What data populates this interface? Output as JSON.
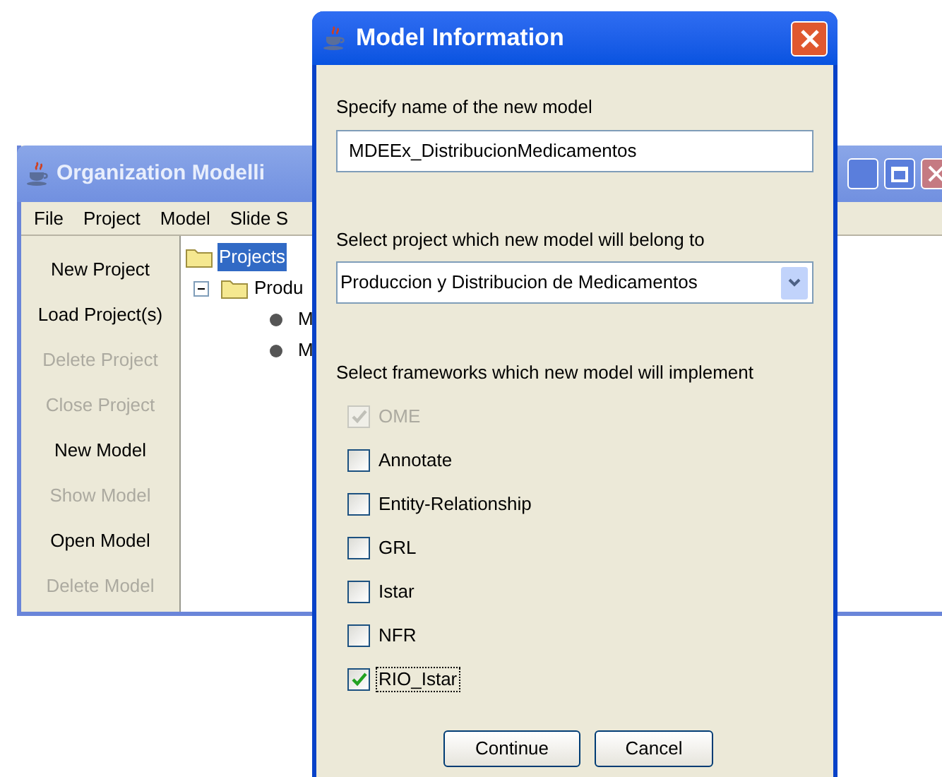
{
  "main_window": {
    "title": "Organization Modelli",
    "menu": [
      "File",
      "Project",
      "Model",
      "Slide S"
    ],
    "actions": [
      {
        "label": "New Project",
        "disabled": false
      },
      {
        "label": "Load Project(s)",
        "disabled": false
      },
      {
        "label": "Delete Project",
        "disabled": true
      },
      {
        "label": "Close Project",
        "disabled": true
      },
      {
        "label": "New Model",
        "disabled": false
      },
      {
        "label": "Show Model",
        "disabled": true
      },
      {
        "label": "Open Model",
        "disabled": false
      },
      {
        "label": "Delete Model",
        "disabled": true
      }
    ],
    "tree": [
      {
        "label": "Projects",
        "selected": true,
        "children": [
          {
            "label": "Produ",
            "selected": false,
            "expanded": true,
            "children": [
              {
                "label": "M",
                "selected": false
              },
              {
                "label": "M",
                "selected": false
              }
            ]
          }
        ]
      }
    ]
  },
  "dialog": {
    "title": "Model Information",
    "name_label": "Specify name of the new model",
    "name_value": "MDEEx_DistribucionMedicamentos",
    "project_label": "Select project which new model will belong to",
    "project_value": "Produccion y Distribucion de Medicamentos",
    "frameworks_label": "Select frameworks which new model will  implement",
    "frameworks": [
      {
        "label": "OME",
        "checked": true,
        "disabled": true,
        "focused": false
      },
      {
        "label": "Annotate",
        "checked": false,
        "disabled": false,
        "focused": false
      },
      {
        "label": "Entity-Relationship",
        "checked": false,
        "disabled": false,
        "focused": false
      },
      {
        "label": "GRL",
        "checked": false,
        "disabled": false,
        "focused": false
      },
      {
        "label": "Istar",
        "checked": false,
        "disabled": false,
        "focused": false
      },
      {
        "label": "NFR",
        "checked": false,
        "disabled": false,
        "focused": false
      },
      {
        "label": "RIO_Istar",
        "checked": true,
        "disabled": false,
        "focused": true
      }
    ],
    "buttons": [
      "Continue",
      "Cancel"
    ]
  }
}
